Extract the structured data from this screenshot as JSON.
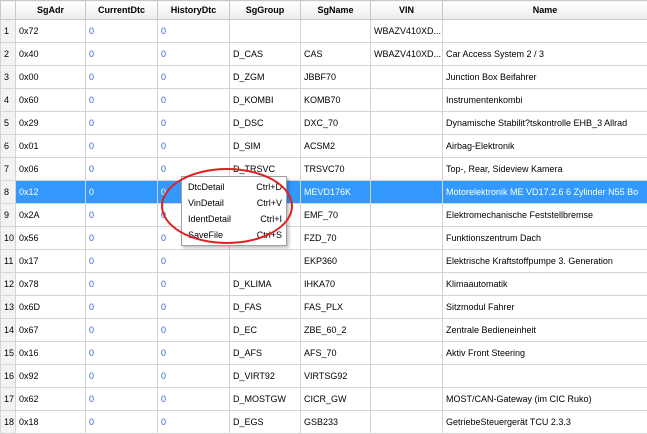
{
  "columns": [
    "",
    "SgAdr",
    "CurrentDtc",
    "HistoryDtc",
    "SgGroup",
    "SgName",
    "VIN",
    "Name"
  ],
  "rows": [
    {
      "n": "1",
      "adr": "0x72",
      "cur": "0",
      "hist": "0",
      "group": "",
      "sgname": "",
      "vin": "WBAZV410XD...",
      "name": ""
    },
    {
      "n": "2",
      "adr": "0x40",
      "cur": "0",
      "hist": "0",
      "group": "D_CAS",
      "sgname": "CAS",
      "vin": "WBAZV410XD...",
      "name": "Car Access System 2 / 3"
    },
    {
      "n": "3",
      "adr": "0x00",
      "cur": "0",
      "hist": "0",
      "group": "D_ZGM",
      "sgname": "JBBF70",
      "vin": "",
      "name": "Junction Box Beifahrer"
    },
    {
      "n": "4",
      "adr": "0x60",
      "cur": "0",
      "hist": "0",
      "group": "D_KOMBI",
      "sgname": "KOMB70",
      "vin": "",
      "name": "Instrumentenkombi"
    },
    {
      "n": "5",
      "adr": "0x29",
      "cur": "0",
      "hist": "0",
      "group": "D_DSC",
      "sgname": "DXC_70",
      "vin": "",
      "name": "Dynamische Stabilit?tskontrolle EHB_3 Allrad"
    },
    {
      "n": "6",
      "adr": "0x01",
      "cur": "0",
      "hist": "0",
      "group": "D_SIM",
      "sgname": "ACSM2",
      "vin": "",
      "name": "Airbag-Elektronik"
    },
    {
      "n": "7",
      "adr": "0x06",
      "cur": "0",
      "hist": "0",
      "group": "D_TRSVC",
      "sgname": "TRSVC70",
      "vin": "",
      "name": "Top-, Rear, Sideview Kamera"
    },
    {
      "n": "8",
      "adr": "0x12",
      "cur": "0",
      "hist": "0",
      "group": "D_MOTOR",
      "sgname": "MEVD176K",
      "vin": "",
      "name": "Motorelektronik ME VD17.2.6 6 Zylinder N55 Bo"
    },
    {
      "n": "9",
      "adr": "0x2A",
      "cur": "0",
      "hist": "0",
      "group": "",
      "sgname": "EMF_70",
      "vin": "",
      "name": "Elektromechanische Feststellbremse"
    },
    {
      "n": "10",
      "adr": "0x56",
      "cur": "0",
      "hist": "0",
      "group": "",
      "sgname": "FZD_70",
      "vin": "",
      "name": "Funktionszentrum Dach"
    },
    {
      "n": "11",
      "adr": "0x17",
      "cur": "0",
      "hist": "0",
      "group": "",
      "sgname": "EKP360",
      "vin": "",
      "name": "Elektrische Kraftstoffpumpe 3. Generation"
    },
    {
      "n": "12",
      "adr": "0x78",
      "cur": "0",
      "hist": "0",
      "group": "D_KLIMA",
      "sgname": "IHKA70",
      "vin": "",
      "name": "Klimaautomatik"
    },
    {
      "n": "13",
      "adr": "0x6D",
      "cur": "0",
      "hist": "0",
      "group": "D_FAS",
      "sgname": "FAS_PLX",
      "vin": "",
      "name": "Sitzmodul Fahrer"
    },
    {
      "n": "14",
      "adr": "0x67",
      "cur": "0",
      "hist": "0",
      "group": "D_EC",
      "sgname": "ZBE_60_2",
      "vin": "",
      "name": "Zentrale Bedieneinheit"
    },
    {
      "n": "15",
      "adr": "0x16",
      "cur": "0",
      "hist": "0",
      "group": "D_AFS",
      "sgname": "AFS_70",
      "vin": "",
      "name": "Aktiv Front Steering"
    },
    {
      "n": "16",
      "adr": "0x92",
      "cur": "0",
      "hist": "0",
      "group": "D_VIRT92",
      "sgname": "VIRTSG92",
      "vin": "",
      "name": ""
    },
    {
      "n": "17",
      "adr": "0x62",
      "cur": "0",
      "hist": "0",
      "group": "D_MOSTGW",
      "sgname": "CICR_GW",
      "vin": "",
      "name": "MOST/CAN-Gateway (im CIC Ruko)"
    },
    {
      "n": "18",
      "adr": "0x18",
      "cur": "0",
      "hist": "0",
      "group": "D_EGS",
      "sgname": "GSB233",
      "vin": "",
      "name": "GetriebeSteuergerät TCU 2.3.3"
    }
  ],
  "selected_row": 8,
  "context_menu": [
    {
      "label": "DtcDetail",
      "shortcut": "Ctrl+D"
    },
    {
      "label": "VinDetail",
      "shortcut": "Ctrl+V"
    },
    {
      "label": "IdentDetail",
      "shortcut": "Ctrl+I"
    },
    {
      "label": "SaveFile",
      "shortcut": "Ctrl+S"
    }
  ],
  "colors": {
    "selection": "#3399ff",
    "dtc_value": "#2e5fd1",
    "annotation": "#e02020"
  }
}
